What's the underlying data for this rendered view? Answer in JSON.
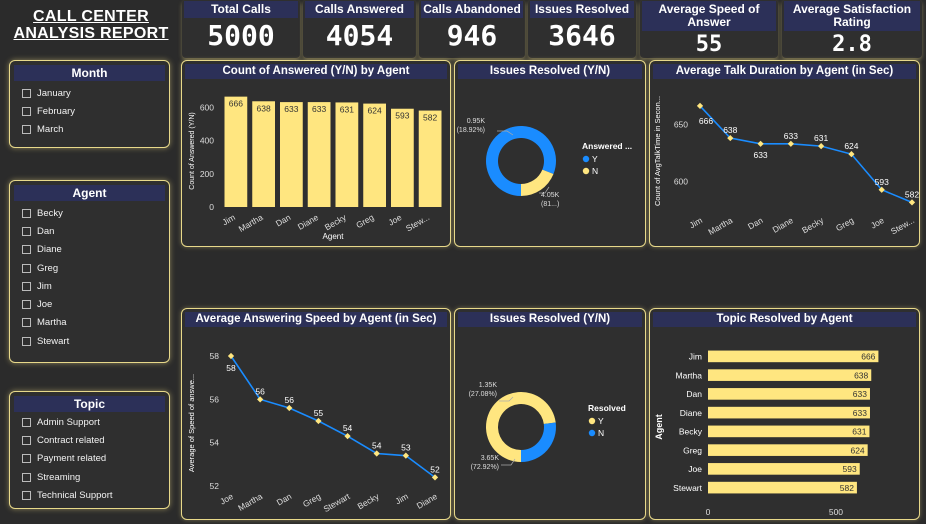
{
  "report": {
    "title_line1": "CALL CENTER",
    "title_line2": "ANALYSIS REPORT"
  },
  "slicers": {
    "month": {
      "title": "Month",
      "items": [
        "January",
        "February",
        "March"
      ]
    },
    "agent": {
      "title": "Agent",
      "items": [
        "Becky",
        "Dan",
        "Diane",
        "Greg",
        "Jim",
        "Joe",
        "Martha",
        "Stewart"
      ]
    },
    "topic": {
      "title": "Topic",
      "items": [
        "Admin Support",
        "Contract related",
        "Payment related",
        "Streaming",
        "Technical Support"
      ]
    }
  },
  "kpis": {
    "total_calls": {
      "label": "Total Calls",
      "value": "5000"
    },
    "calls_answered": {
      "label": "Calls Answered",
      "value": "4054"
    },
    "calls_abandoned": {
      "label": "Calls Abandoned",
      "value": "946"
    },
    "issues_resolved": {
      "label": "Issues Resolved",
      "value": "3646"
    },
    "avg_speed": {
      "label": "Average Speed of Answer",
      "value": "55"
    },
    "avg_satisfaction": {
      "label": "Average Satisfaction Rating",
      "value": "2.8"
    }
  },
  "colors": {
    "accent_yellow": "#ffe680",
    "accent_blue": "#1a8cff",
    "panel_header": "#2c3058",
    "border": "#e8d98a"
  },
  "chart_data": [
    {
      "id": "answered_by_agent",
      "type": "bar",
      "title": "Count of Answered (Y/N) by Agent",
      "xlabel": "Agent",
      "ylabel": "Count of Answered (Y/N)",
      "categories": [
        "Jim",
        "Martha",
        "Dan",
        "Diane",
        "Becky",
        "Greg",
        "Joe",
        "Stew..."
      ],
      "values": [
        666,
        638,
        633,
        633,
        631,
        624,
        593,
        582
      ],
      "yticks": [
        0,
        200,
        400,
        600
      ],
      "ylim": [
        0,
        700
      ]
    },
    {
      "id": "issues_resolved_answered",
      "type": "pie",
      "title": "Issues Resolved (Y/N)",
      "legend_title": "Answered ...",
      "slices": [
        {
          "name": "Y",
          "value": 4054,
          "label": "4.05K",
          "pct": "(81...)"
        },
        {
          "name": "N",
          "value": 946,
          "label": "0.95K",
          "pct": "(18.92%)"
        }
      ]
    },
    {
      "id": "talk_duration",
      "type": "line",
      "title": "Average Talk Duration by Agent (in Sec)",
      "xlabel": "Agent",
      "ylabel": "Count of AvgTalkTime in Secon...",
      "categories": [
        "Jim",
        "Martha",
        "Dan",
        "Diane",
        "Becky",
        "Greg",
        "Joe",
        "Stew..."
      ],
      "values": [
        666,
        638,
        633,
        633,
        631,
        624,
        593,
        582
      ],
      "yticks": [
        600,
        650
      ],
      "ylim": [
        578,
        672
      ]
    },
    {
      "id": "answer_speed",
      "type": "line",
      "title": "Average Answering Speed by Agent (in Sec)",
      "xlabel": "Agent",
      "ylabel": "Average of Speed of answe...",
      "categories": [
        "Joe",
        "Martha",
        "Dan",
        "Greg",
        "Stewart",
        "Becky",
        "Jim",
        "Diane"
      ],
      "values": [
        58,
        56,
        55.6,
        55,
        54.3,
        53.5,
        53.4,
        52.4
      ],
      "data_labels": [
        "58",
        "56",
        "56",
        "55",
        "54",
        "54",
        "53",
        "52"
      ],
      "yticks": [
        52,
        54,
        56,
        58
      ],
      "ylim": [
        52,
        58
      ]
    },
    {
      "id": "issues_resolved",
      "type": "pie",
      "title": "Issues Resolved (Y/N)",
      "legend_title": "Resolved",
      "slices": [
        {
          "name": "Y",
          "value": 3646,
          "label": "3.65K",
          "pct": "(72.92%)"
        },
        {
          "name": "N",
          "value": 1354,
          "label": "1.35K",
          "pct": "(27.08%)"
        }
      ]
    },
    {
      "id": "topic_resolved",
      "type": "bar",
      "orientation": "horizontal",
      "title": "Topic Resolved by Agent",
      "xlabel": "Count of Resolved",
      "ylabel": "Agent",
      "categories": [
        "Jim",
        "Martha",
        "Dan",
        "Diane",
        "Becky",
        "Greg",
        "Joe",
        "Stewart"
      ],
      "values": [
        666,
        638,
        633,
        633,
        631,
        624,
        593,
        582
      ],
      "xticks": [
        0,
        500
      ],
      "xlim": [
        0,
        680
      ]
    }
  ]
}
